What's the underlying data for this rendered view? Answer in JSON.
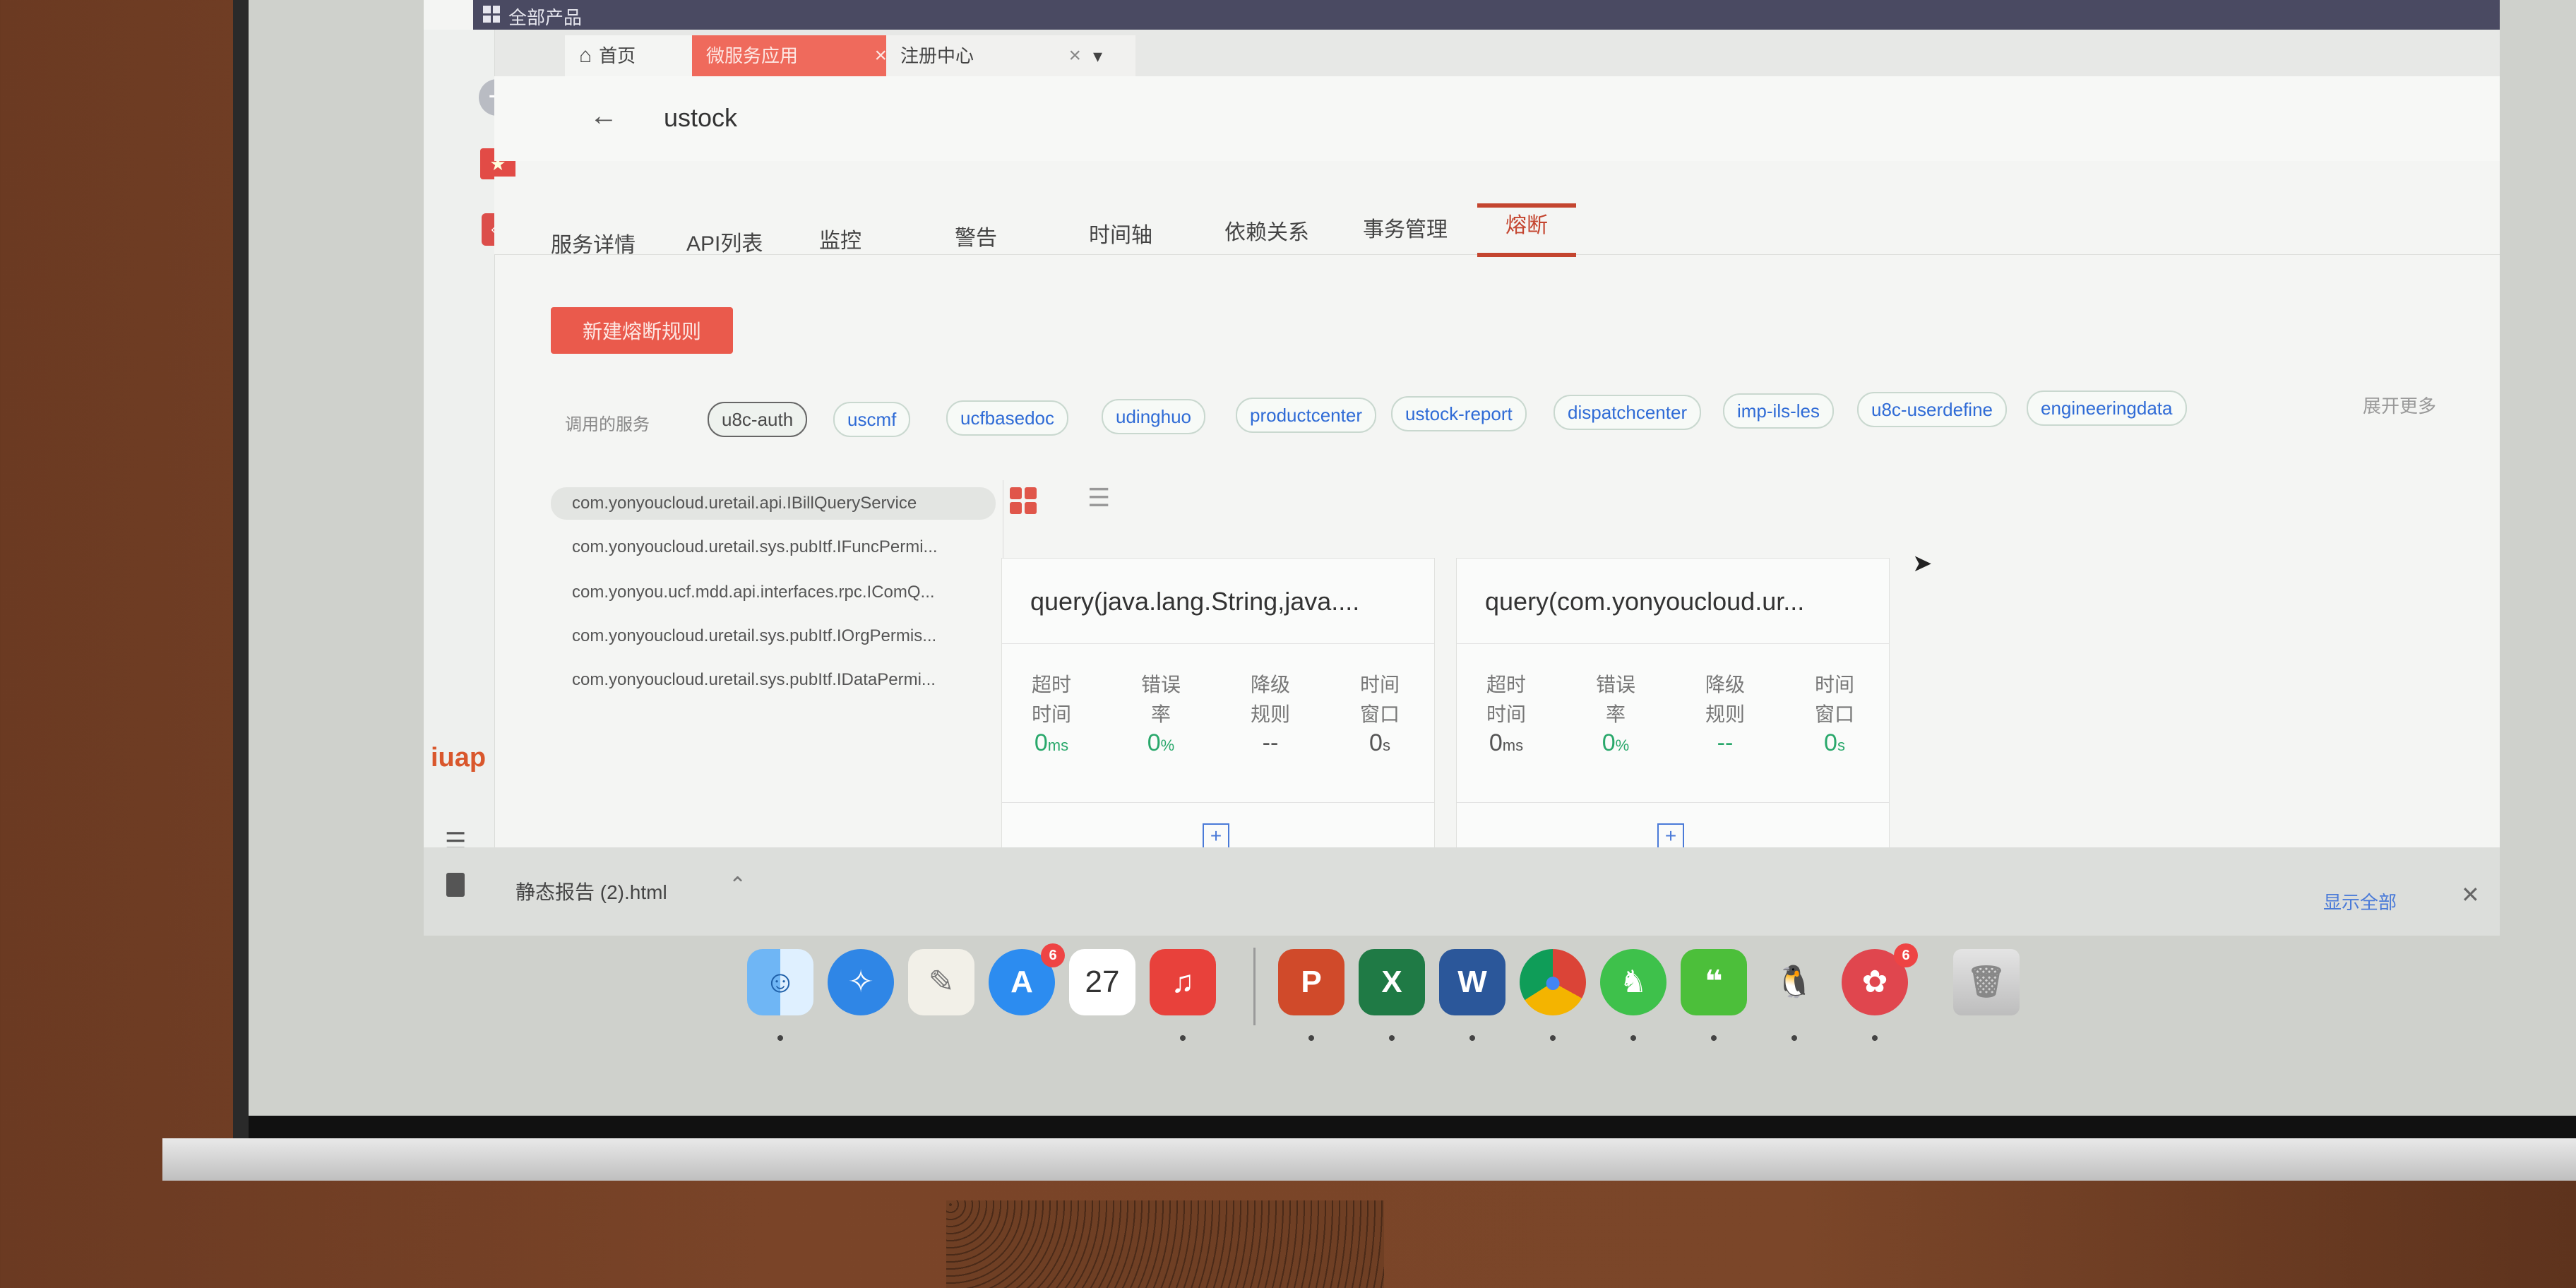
{
  "topbar": {
    "title": "全部产品"
  },
  "tabs": [
    {
      "label": "首页"
    },
    {
      "label": "微服务应用"
    },
    {
      "label": "注册中心"
    }
  ],
  "header": {
    "app_name": "ustock"
  },
  "subtabs": [
    "服务详情",
    "API列表",
    "监控",
    "警告",
    "时间轴",
    "依赖关系",
    "事务管理",
    "熔断"
  ],
  "new_rule_button": "新建熔断规则",
  "services": {
    "label": "调用的服务",
    "chips": [
      "u8c-auth",
      "uscmf",
      "ucfbasedoc",
      "udinghuo",
      "productcenter",
      "ustock-report",
      "dispatchcenter",
      "imp-ils-les",
      "u8c-userdefine",
      "engineeringdata"
    ],
    "expand_more": "展开更多"
  },
  "interfaces": [
    "com.yonyoucloud.uretail.api.IBillQueryService",
    "com.yonyoucloud.uretail.sys.pubItf.IFuncPermi...",
    "com.yonyou.ucf.mdd.api.interfaces.rpc.IComQ...",
    "com.yonyoucloud.uretail.sys.pubItf.IOrgPermis...",
    "com.yonyoucloud.uretail.sys.pubItf.IDataPermi..."
  ],
  "cards": [
    {
      "title": "query(java.lang.String,java....",
      "metrics": [
        {
          "label": "超时时间",
          "value": "0",
          "unit": "ms"
        },
        {
          "label": "错误率",
          "value": "0",
          "unit": "%"
        },
        {
          "label": "降级规则",
          "value": "--",
          "unit": ""
        },
        {
          "label": "时间窗口",
          "value": "0",
          "unit": "s"
        }
      ]
    },
    {
      "title": "query(com.yonyoucloud.ur...",
      "metrics": [
        {
          "label": "超时时间",
          "value": "0",
          "unit": "ms"
        },
        {
          "label": "错误率",
          "value": "0",
          "unit": "%"
        },
        {
          "label": "降级规则",
          "value": "--",
          "unit": ""
        },
        {
          "label": "时间窗口",
          "value": "0",
          "unit": "s"
        }
      ]
    }
  ],
  "download_bar": {
    "file_name": "静态报告 (2).html",
    "show_all": "显示全部"
  },
  "dock": {
    "calendar_day": "27",
    "icons": [
      "finder-icon",
      "safari-icon",
      "textedit-icon",
      "app-store-icon",
      "calendar-icon",
      "music-icon",
      "powerpoint-icon",
      "excel-icon",
      "word-icon",
      "chrome-icon",
      "evernote-icon",
      "wechat-icon",
      "qq-icon",
      "app-icon",
      "trash-icon"
    ],
    "powerpoint_letter": "P",
    "excel_letter": "X",
    "word_letter": "W"
  },
  "colors": {
    "accent": "#ea5a4c",
    "active_tab": "#c4452f",
    "link": "#2f6bd6",
    "metric_value": "#29a86b"
  }
}
